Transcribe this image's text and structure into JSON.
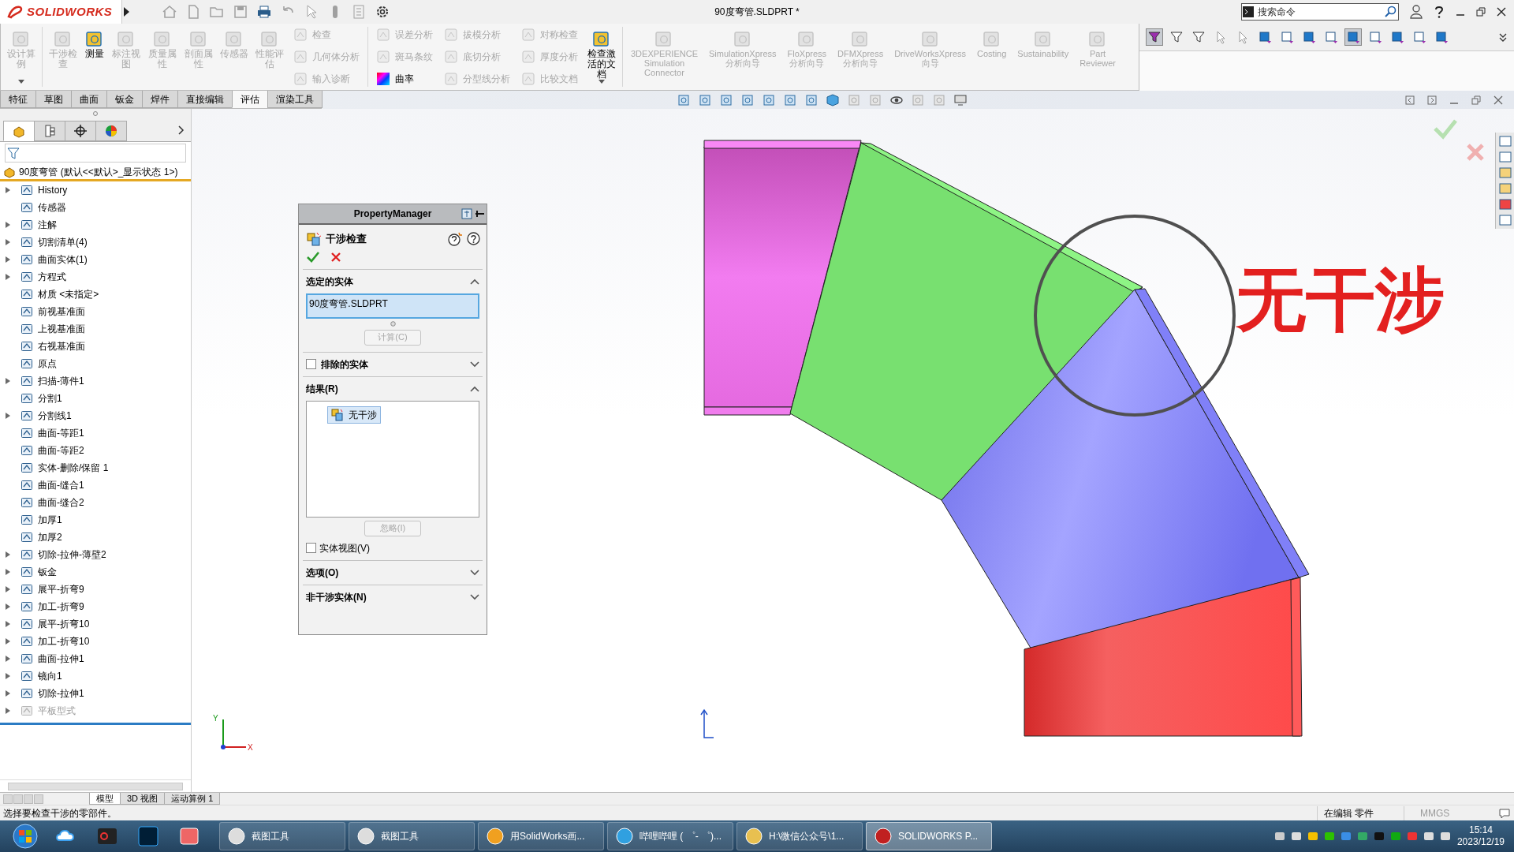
{
  "title_bar": {
    "logo": "SOLIDWORKS",
    "title": "90度弯管.SLDPRT *",
    "search": {
      "placeholder": "搜索命令"
    }
  },
  "ribbon_groups": [
    [
      {
        "kind": "large",
        "label": "设计算例",
        "disabled": true,
        "dropdown": true
      }
    ],
    [
      {
        "kind": "large",
        "label": "干涉检查",
        "disabled": true
      },
      {
        "kind": "large",
        "label": "测量",
        "disabled": false
      },
      {
        "kind": "large",
        "label": "标注视图",
        "disabled": true
      },
      {
        "kind": "large",
        "label": "质量属性",
        "disabled": true
      },
      {
        "kind": "large",
        "label": "剖面属性",
        "disabled": true
      },
      {
        "kind": "large",
        "label": "传感器",
        "disabled": true
      },
      {
        "kind": "large",
        "label": "性能评估",
        "disabled": true
      },
      {
        "kind": "stack",
        "items": [
          {
            "label": "检查",
            "disabled": true
          },
          {
            "label": "几何体分析",
            "disabled": true
          },
          {
            "label": "输入诊断",
            "disabled": true
          }
        ]
      }
    ],
    [
      {
        "kind": "stack",
        "items": [
          {
            "label": "误差分析",
            "disabled": true
          },
          {
            "label": "斑马条纹",
            "disabled": true
          },
          {
            "label": "曲率",
            "disabled": false
          }
        ]
      },
      {
        "kind": "stack",
        "items": [
          {
            "label": "拔模分析",
            "disabled": true
          },
          {
            "label": "底切分析",
            "disabled": true
          },
          {
            "label": "分型线分析",
            "disabled": true
          }
        ]
      },
      {
        "kind": "stack",
        "items": [
          {
            "label": "对称检查",
            "disabled": true
          },
          {
            "label": "厚度分析",
            "disabled": true
          },
          {
            "label": "比较文档",
            "disabled": true
          }
        ]
      },
      {
        "kind": "large",
        "label": "检查激活的文档",
        "disabled": false,
        "dropdown": true
      }
    ],
    [
      {
        "kind": "addin",
        "label": "3DEXPERIENCE\nSimulation\nConnector",
        "disabled": true
      },
      {
        "kind": "addin",
        "label": "SimulationXpress\n分析向导",
        "disabled": true
      },
      {
        "kind": "addin",
        "label": "FloXpress\n分析向导",
        "disabled": true
      },
      {
        "kind": "addin",
        "label": "DFMXpress\n分析向导",
        "disabled": true
      },
      {
        "kind": "addin",
        "label": "DriveWorksXpress\n向导",
        "disabled": true
      },
      {
        "kind": "addin",
        "label": "Costing",
        "disabled": true
      },
      {
        "kind": "addin",
        "label": "Sustainability",
        "disabled": true
      },
      {
        "kind": "addin",
        "label": "Part\nReviewer",
        "disabled": true
      }
    ]
  ],
  "filter_toolbar": [
    {
      "pressed": true
    },
    {
      "pressed": false
    },
    {
      "pressed": false
    },
    {
      "pressed": false
    },
    {
      "pressed": false
    },
    {
      "pressed": false
    },
    {
      "pressed": false
    },
    {
      "pressed": false
    },
    {
      "pressed": false
    },
    {
      "pressed": true
    },
    {
      "pressed": false
    },
    {
      "pressed": false
    },
    {
      "pressed": false
    },
    {
      "pressed": false
    }
  ],
  "tabs": [
    {
      "label": "特征",
      "selected": false
    },
    {
      "label": "草图",
      "selected": false
    },
    {
      "label": "曲面",
      "selected": false
    },
    {
      "label": "钣金",
      "selected": false
    },
    {
      "label": "焊件",
      "selected": false
    },
    {
      "label": "直接编辑",
      "selected": false
    },
    {
      "label": "评估",
      "selected": true
    },
    {
      "label": "渲染工具",
      "selected": false
    }
  ],
  "panel_tabs": [
    {
      "selected": true
    },
    {
      "selected": false
    },
    {
      "selected": false
    },
    {
      "selected": false
    }
  ],
  "feature_tree": {
    "root": "90度弯管  (默认<<默认>_显示状态 1>)",
    "items": [
      {
        "label": "History",
        "expandable": true,
        "suppressed": false
      },
      {
        "label": "传感器",
        "expandable": false,
        "suppressed": false
      },
      {
        "label": "注解",
        "expandable": true,
        "suppressed": false
      },
      {
        "label": "切割清单(4)",
        "expandable": true,
        "suppressed": false
      },
      {
        "label": "曲面实体(1)",
        "expandable": true,
        "suppressed": false
      },
      {
        "label": "方程式",
        "expandable": true,
        "suppressed": false
      },
      {
        "label": "材质 <未指定>",
        "expandable": false,
        "suppressed": false
      },
      {
        "label": "前视基准面",
        "expandable": false,
        "suppressed": false
      },
      {
        "label": "上视基准面",
        "expandable": false,
        "suppressed": false
      },
      {
        "label": "右视基准面",
        "expandable": false,
        "suppressed": false
      },
      {
        "label": "原点",
        "expandable": false,
        "suppressed": false
      },
      {
        "label": "扫描-薄件1",
        "expandable": true,
        "suppressed": false
      },
      {
        "label": "分割1",
        "expandable": false,
        "suppressed": false
      },
      {
        "label": "分割线1",
        "expandable": true,
        "suppressed": false
      },
      {
        "label": "曲面-等距1",
        "expandable": false,
        "suppressed": false
      },
      {
        "label": "曲面-等距2",
        "expandable": false,
        "suppressed": false
      },
      {
        "label": "实体-删除/保留 1",
        "expandable": false,
        "suppressed": false
      },
      {
        "label": "曲面-缝合1",
        "expandable": false,
        "suppressed": false
      },
      {
        "label": "曲面-缝合2",
        "expandable": false,
        "suppressed": false
      },
      {
        "label": "加厚1",
        "expandable": false,
        "suppressed": false
      },
      {
        "label": "加厚2",
        "expandable": false,
        "suppressed": false
      },
      {
        "label": "切除-拉伸-薄壁2",
        "expandable": true,
        "suppressed": false
      },
      {
        "label": "钣金",
        "expandable": true,
        "suppressed": false
      },
      {
        "label": "展平-折弯9",
        "expandable": true,
        "suppressed": false
      },
      {
        "label": "加工-折弯9",
        "expandable": true,
        "suppressed": false
      },
      {
        "label": "展平-折弯10",
        "expandable": true,
        "suppressed": false
      },
      {
        "label": "加工-折弯10",
        "expandable": true,
        "suppressed": false
      },
      {
        "label": "曲面-拉伸1",
        "expandable": true,
        "suppressed": false
      },
      {
        "label": "镜向1",
        "expandable": true,
        "suppressed": false
      },
      {
        "label": "切除-拉伸1",
        "expandable": true,
        "suppressed": false
      },
      {
        "label": "平板型式",
        "expandable": true,
        "suppressed": true
      }
    ]
  },
  "property_manager": {
    "header": "PropertyManager",
    "feature": "干涉检查",
    "sections": [
      {
        "kind": "selection",
        "title": "选定的实体",
        "expanded": true,
        "field_value": "90度弯管.SLDPRT",
        "button": {
          "label": "计算(C)",
          "disabled": true
        }
      },
      {
        "kind": "check",
        "title": "排除的实体",
        "checked": false,
        "expanded": false
      },
      {
        "kind": "results",
        "title": "结果(R)",
        "expanded": true,
        "results": [
          {
            "label": "无干涉",
            "selected": true
          }
        ],
        "button": {
          "label": "忽略(I)",
          "disabled": true
        },
        "option": {
          "label": "实体视图(V)",
          "checked": false
        }
      },
      {
        "kind": "plain",
        "title": "选项(O)",
        "expanded": false
      },
      {
        "kind": "plain",
        "title": "非干涉实体(N)",
        "expanded": false
      }
    ]
  },
  "viewport": {
    "callout": "无干涉",
    "triad": {
      "x": "X",
      "y": "Y"
    }
  },
  "model_tabs": [
    {
      "label": "模型",
      "selected": true
    },
    {
      "label": "3D 视图",
      "selected": false
    },
    {
      "label": "运动算例 1",
      "selected": false
    }
  ],
  "status_bar": {
    "message": "选择要检查干涉的零部件。",
    "mode": "在编辑 零件",
    "units": "MMGS"
  },
  "taskbar": {
    "windows": [
      {
        "label": "截图工具",
        "active": false
      },
      {
        "label": "截图工具",
        "active": false
      },
      {
        "label": "用SolidWorks画...",
        "active": false
      },
      {
        "label": "哔哩哔哩 ( ゜- ゜)...",
        "active": false
      },
      {
        "label": "H:\\微信公众号\\1...",
        "active": false
      },
      {
        "label": "SOLIDWORKS P...",
        "active": true
      }
    ],
    "time": "15:14",
    "date": "2023/12/19"
  }
}
